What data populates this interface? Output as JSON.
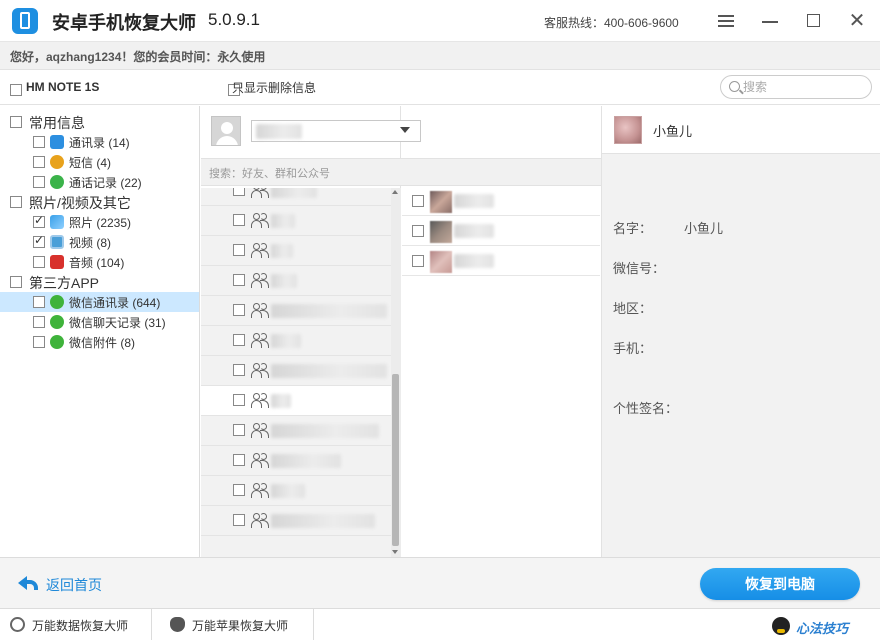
{
  "app": {
    "title": "安卓手机恢复大师",
    "version": "5.0.9.1",
    "hotline": "客服热线：400-606-9600"
  },
  "user": {
    "info": "您好，aqzhang1234！您的会员时间：永久使用"
  },
  "toolbar": {
    "device_name": "HM NOTE 1S",
    "only_deleted_label": "只显示删除信息",
    "search_placeholder": "搜索"
  },
  "tree": {
    "categories": [
      {
        "label": "常用信息",
        "checked": false
      },
      {
        "label": "照片/视频及其它",
        "checked": false
      },
      {
        "label": "第三方APP",
        "checked": false
      }
    ],
    "items": [
      {
        "label": "通讯录 (14)",
        "icon": "contacts-icon",
        "checked": false
      },
      {
        "label": "短信 (4)",
        "icon": "sms-icon",
        "checked": false
      },
      {
        "label": "通话记录 (22)",
        "icon": "call-log-icon",
        "checked": false
      },
      {
        "label": "照片 (2235)",
        "icon": "photos-icon",
        "checked": true
      },
      {
        "label": "视频 (8)",
        "icon": "video-icon",
        "checked": true
      },
      {
        "label": "音频 (104)",
        "icon": "audio-icon",
        "checked": false
      },
      {
        "label": "微信通讯录 (644)",
        "icon": "wechat-icon",
        "checked": false,
        "selected": true
      },
      {
        "label": "微信聊天记录 (31)",
        "icon": "wechat-icon",
        "checked": false
      },
      {
        "label": "微信附件 (8)",
        "icon": "wechat-icon",
        "checked": false
      }
    ]
  },
  "contacts": {
    "search_hint": "搜索：好友、群和公众号"
  },
  "detail": {
    "name": "小鱼儿",
    "fields": [
      {
        "label": "名字：",
        "value": "小鱼儿"
      },
      {
        "label": "微信号：",
        "value": ""
      },
      {
        "label": "地区：",
        "value": ""
      },
      {
        "label": "手机：",
        "value": ""
      },
      {
        "label": "个性签名：",
        "value": ""
      }
    ]
  },
  "actions": {
    "back_label": "返回首页",
    "recover_label": "恢复到电脑"
  },
  "footer": {
    "tabs": [
      "万能数据恢复大师",
      "万能苹果恢复大师"
    ],
    "watermark": "心法技巧"
  },
  "colors": {
    "accent": "#1e88d8",
    "selected_row": "#cce8ff",
    "wechat_green": "#3fb33b"
  }
}
